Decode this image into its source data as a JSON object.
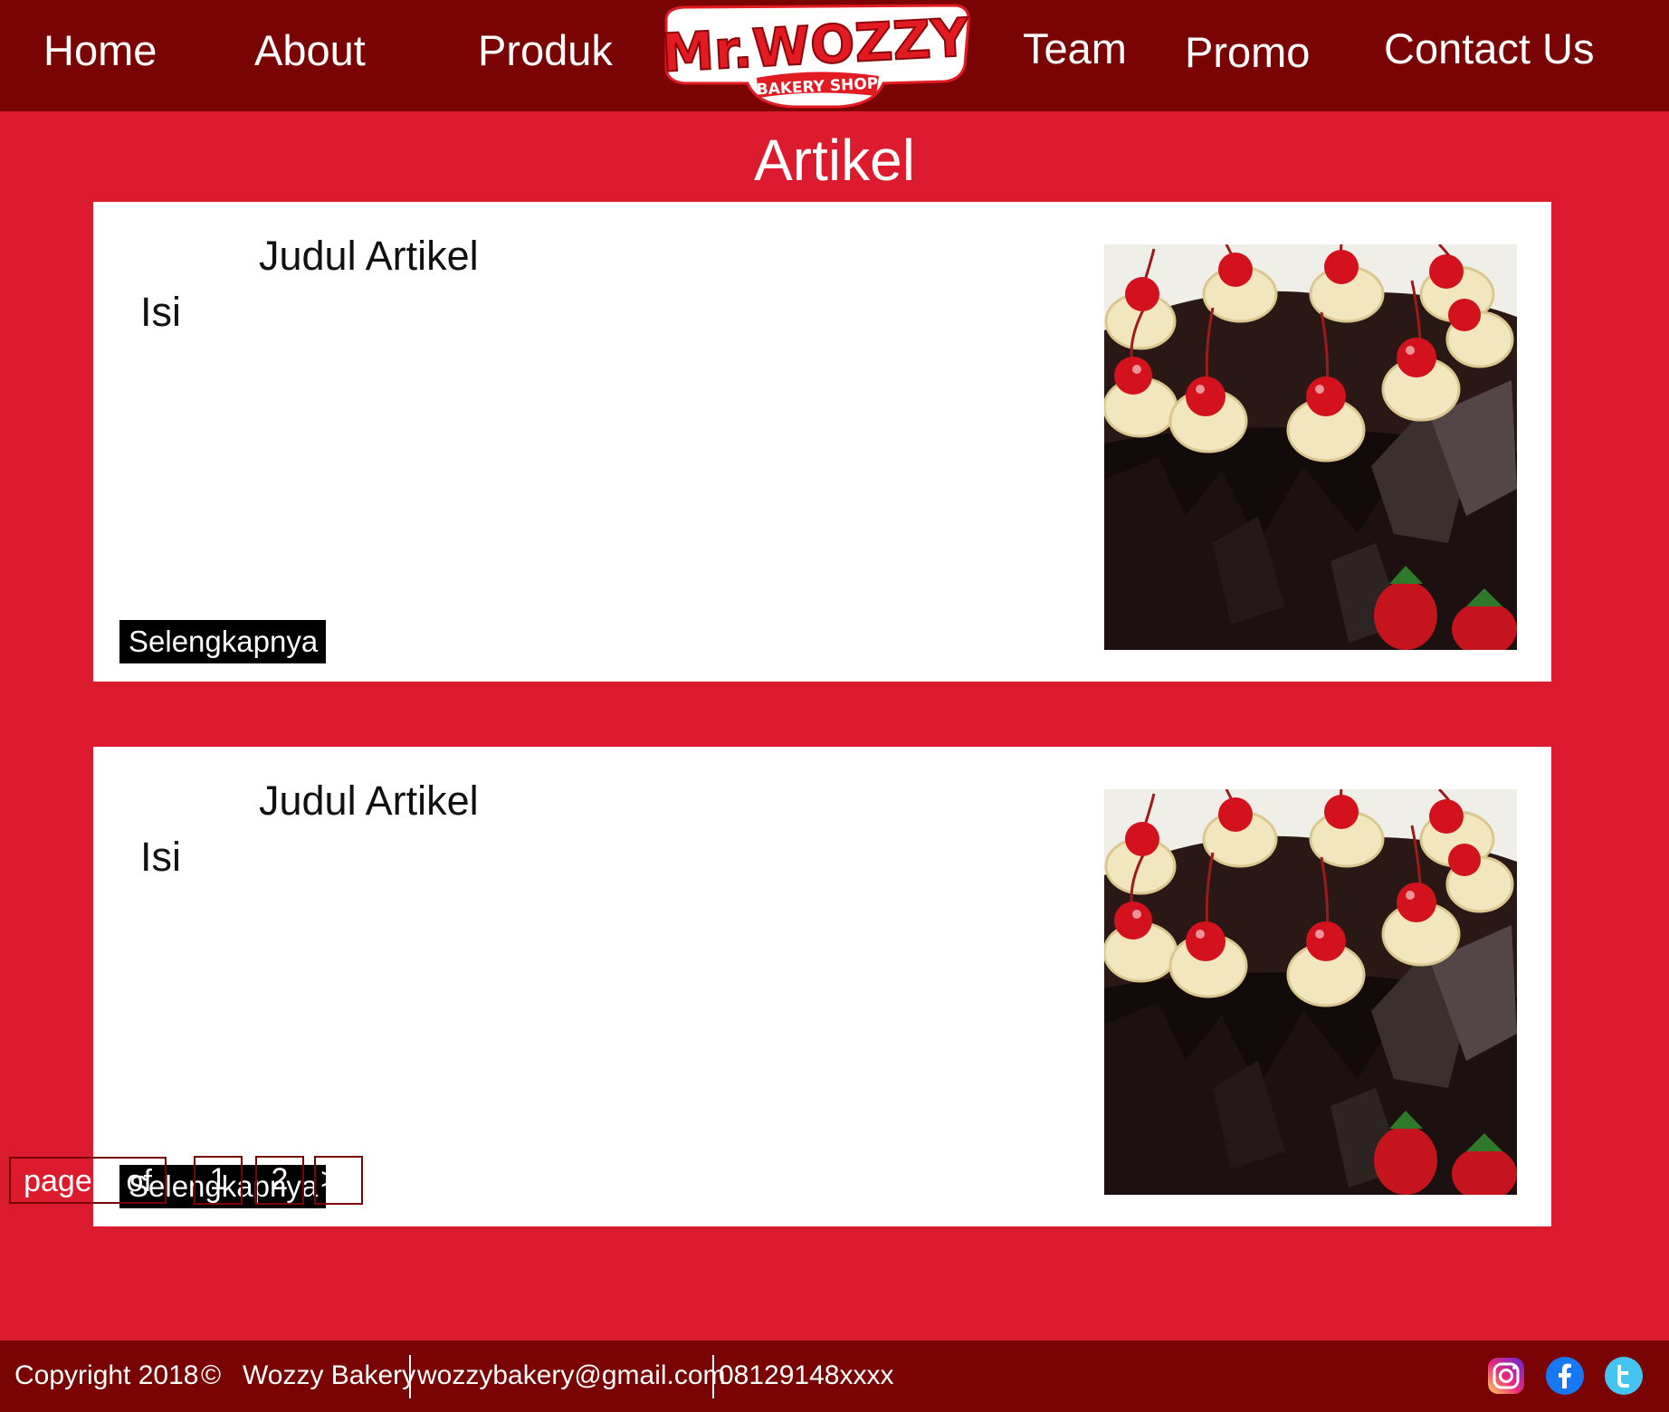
{
  "nav": {
    "items": [
      {
        "label": "Home"
      },
      {
        "label": "About"
      },
      {
        "label": "Produk"
      },
      {
        "label": "Team"
      },
      {
        "label": "Promo"
      },
      {
        "label": "Contact Us"
      }
    ],
    "logo": {
      "main": "Mr.WOZZY",
      "sub": "BAKERY SHOP"
    }
  },
  "main": {
    "title": "Artikel",
    "articles": [
      {
        "title": "Judul Artikel",
        "body": "Isi",
        "more_label": "Selengkapnya",
        "image": "black-forest-cake-image"
      },
      {
        "title": "Judul Artikel",
        "body": "Isi",
        "more_label": "Selengkapnya",
        "image": "black-forest-cake-image"
      }
    ]
  },
  "pagination": {
    "label": "page 1 of",
    "pages": [
      "1",
      "2"
    ],
    "next_label": ">>"
  },
  "footer": {
    "copyright": "Copyright 2018",
    "copyright_symbol": "©",
    "company": "Wozzy Bakery",
    "email": "wozzybakery@gmail.com",
    "phone": "08129148xxxx",
    "social": [
      "instagram-icon",
      "facebook-icon",
      "twitter-icon"
    ]
  },
  "colors": {
    "nav_bg": "#7a0304",
    "main_bg": "#dc1c2e",
    "card_bg": "#ffffff",
    "button_bg": "#000000"
  }
}
